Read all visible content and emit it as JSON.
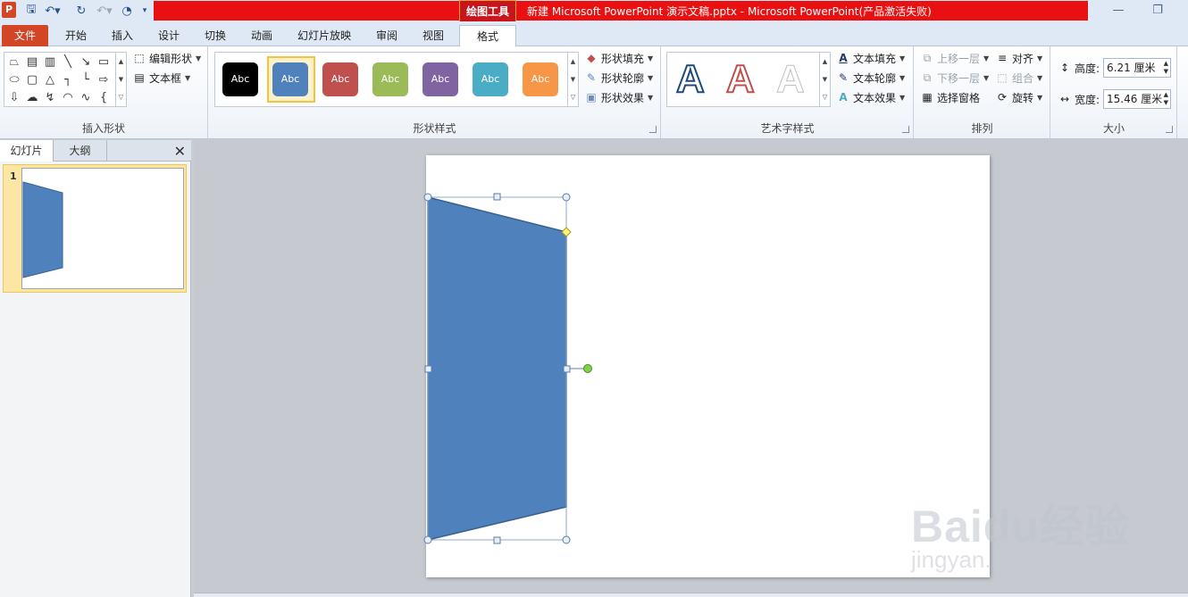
{
  "window": {
    "context_tab": "绘图工具",
    "title": "新建 Microsoft PowerPoint 演示文稿.pptx  -  Microsoft PowerPoint(产品激活失败)"
  },
  "tabs": [
    "文件",
    "开始",
    "插入",
    "设计",
    "切换",
    "动画",
    "幻灯片放映",
    "审阅",
    "视图",
    "格式"
  ],
  "ribbon": {
    "insert_shapes": {
      "label": "插入形状",
      "edit_shape": "编辑形状",
      "text_box": "文本框"
    },
    "shape_styles": {
      "label": "形状样式",
      "swatches": [
        {
          "text": "Abc",
          "color": "#000000"
        },
        {
          "text": "Abc",
          "color": "#4f81bd"
        },
        {
          "text": "Abc",
          "color": "#c0504d"
        },
        {
          "text": "Abc",
          "color": "#9bbb59"
        },
        {
          "text": "Abc",
          "color": "#8064a2"
        },
        {
          "text": "Abc",
          "color": "#4bacc6"
        },
        {
          "text": "Abc",
          "color": "#f79646"
        }
      ],
      "fill": "形状填充",
      "outline": "形状轮廓",
      "effects": "形状效果"
    },
    "wordart": {
      "label": "艺术字样式",
      "letter": "A",
      "text_fill": "文本填充",
      "text_outline": "文本轮廓",
      "text_effects": "文本效果"
    },
    "arrange": {
      "label": "排列",
      "bring_forward": "上移一层",
      "send_backward": "下移一层",
      "selection_pane": "选择窗格",
      "align": "对齐",
      "group": "组合",
      "rotate": "旋转"
    },
    "size": {
      "label": "大小",
      "height_label": "高度:",
      "height_value": "6.21 厘米",
      "width_label": "宽度:",
      "width_value": "15.46 厘米"
    }
  },
  "left_panel": {
    "tabs": [
      "幻灯片",
      "大纲"
    ],
    "slide_number": "1"
  },
  "shape": {
    "fill_color": "#4f81bd",
    "outline_color": "#3a6190"
  },
  "watermark": {
    "brand": "Baidu经验",
    "url": "jingyan.baidu.com"
  }
}
